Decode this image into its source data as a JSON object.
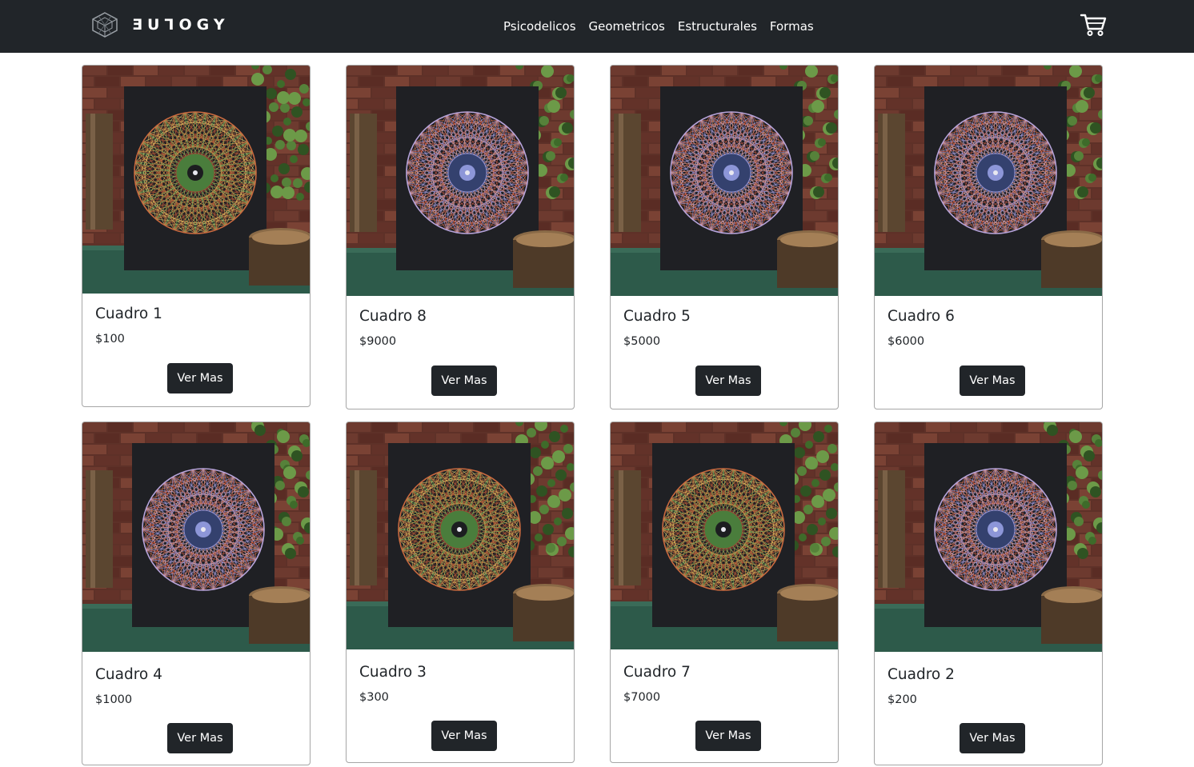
{
  "nav": {
    "brand": "ƎUꞀOGY",
    "links": [
      "Psicodelicos",
      "Geometricos",
      "Estructurales",
      "Formas"
    ]
  },
  "colors": {
    "navbar": "#212529",
    "button": "#212529",
    "page": "#ffffff"
  },
  "icons": {
    "logo": "cube-logo-icon",
    "cart": "cart-icon"
  },
  "products": [
    {
      "title": "Cuadro 1",
      "price": "$100",
      "button": "Ver Mas",
      "pattern": "warm"
    },
    {
      "title": "Cuadro 8",
      "price": "$9000",
      "button": "Ver Mas",
      "pattern": "cool"
    },
    {
      "title": "Cuadro 5",
      "price": "$5000",
      "button": "Ver Mas",
      "pattern": "cool"
    },
    {
      "title": "Cuadro 6",
      "price": "$6000",
      "button": "Ver Mas",
      "pattern": "cool"
    },
    {
      "title": "Cuadro 4",
      "price": "$1000",
      "button": "Ver Mas",
      "pattern": "cool"
    },
    {
      "title": "Cuadro 3",
      "price": "$300",
      "button": "Ver Mas",
      "pattern": "warm"
    },
    {
      "title": "Cuadro 7",
      "price": "$7000",
      "button": "Ver Mas",
      "pattern": "warm"
    },
    {
      "title": "Cuadro 2",
      "price": "$200",
      "button": "Ver Mas",
      "pattern": "cool"
    }
  ]
}
